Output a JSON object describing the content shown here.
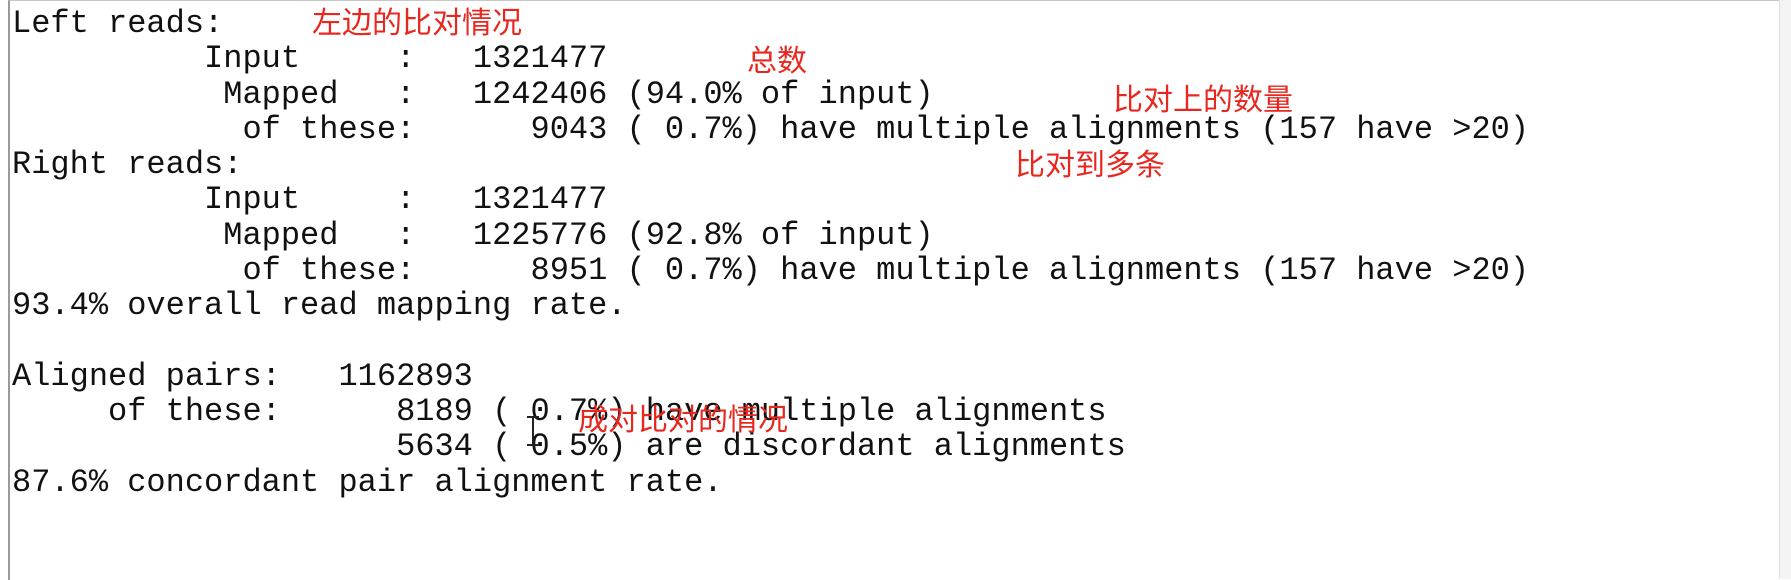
{
  "terminal": {
    "lines": [
      "Left reads:",
      "          Input     :   1321477",
      "           Mapped   :   1242406 (94.0% of input)",
      "            of these:      9043 ( 0.7%) have multiple alignments (157 have >20)",
      "Right reads:",
      "          Input     :   1321477",
      "           Mapped   :   1225776 (92.8% of input)",
      "            of these:      8951 ( 0.7%) have multiple alignments (157 have >20)",
      "93.4% overall read mapping rate.",
      "",
      "Aligned pairs:   1162893",
      "     of these:      8189 ( 0.7%) have multiple alignments",
      "                    5634 ( 0.5%) are discordant alignments",
      "87.6% concordant pair alignment rate."
    ]
  },
  "annotations": {
    "left_reads": "左边的比对情况",
    "total": "总数",
    "mapped_count": "比对上的数量",
    "multi_mapped": "比对到多条",
    "pair_alignment": "成对比对的情况"
  },
  "colors": {
    "annotation": "#e8271f",
    "terminal_text": "#111111",
    "background": "#ffffff"
  },
  "icons": {
    "cursor": "text-cursor-icon"
  }
}
